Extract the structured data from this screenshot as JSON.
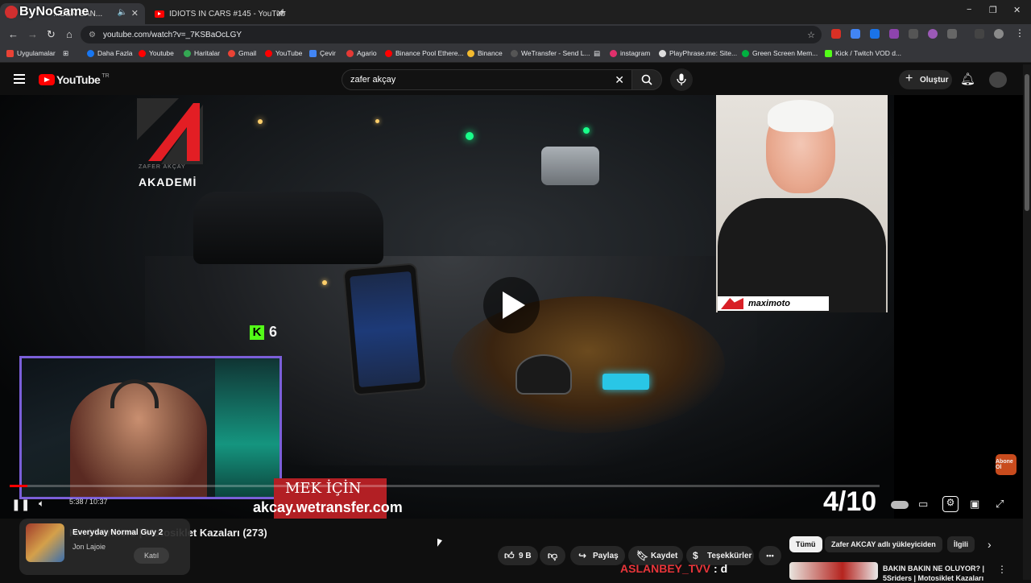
{
  "browser": {
    "tabs": [
      {
        "title": "...DEN SAN...",
        "active": true
      },
      {
        "title": "IDIOTS IN CARS #145 - YouTub",
        "active": false
      }
    ],
    "new_tab_label": "+",
    "url": "youtube.com/watch?v=_7KSBaOcLGY",
    "window_controls": [
      "−",
      "❐",
      "✕"
    ],
    "bookmarks": [
      "Uygulamalar",
      "Daha Fazla",
      "Youtube",
      "Haritalar",
      "Gmail",
      "YouTube",
      "Çevir",
      "Agario",
      "Binance Pool Ethere...",
      "Binance",
      "WeTransfer - Send L...",
      "instagram",
      "PlayPhrase.me: Site...",
      "Green Screen Mem...",
      "Kick / Twitch VOD d..."
    ]
  },
  "overlay_watermark": "ByNoGame",
  "youtube": {
    "logo_text": "YouTube",
    "region": "TR",
    "search_query": "zafer akçay",
    "create_label": "Oluştur"
  },
  "video": {
    "channel_logo_text": "ZAFER AKÇAY",
    "academy_label": "AKADEMİ",
    "inset_brand": "maximoto",
    "kick_label": "K",
    "kick_count": "6",
    "banner_top": "MEK İÇİN",
    "banner_bottom": "akcay.wetransfer.com",
    "counter": "4/10",
    "timecode": "5:38 / 10:37",
    "abone_label": "Abone Ol",
    "progress_fraction": 0.02,
    "colors": {
      "accent": "#ff0000",
      "banner": "#b21f24",
      "kick": "#53fc18",
      "webcam_border": "#7b5fd9"
    }
  },
  "below": {
    "title": "H... | 5Sriders | Motosiklet Kazaları (273)",
    "mini_player": {
      "title": "Everyday Normal Guy 2",
      "artist": "Jon Lajoie",
      "join_label": "Katıl"
    },
    "actions": {
      "like_count": "9 B",
      "share_label": "Paylaş",
      "save_label": "Kaydet",
      "thanks_label": "Teşekkürler",
      "more_label": "•••"
    },
    "chat": {
      "user": "ASLANBEY_TVV",
      "message": ": d"
    },
    "chips": [
      "Tümü",
      "Zafer AKCAY adlı yükleyiciden",
      "İlgili"
    ],
    "suggestion": {
      "title": "BAKIN BAKIN NE OLUYOR? | 5Sriders | Motosiklet Kazaları"
    }
  }
}
